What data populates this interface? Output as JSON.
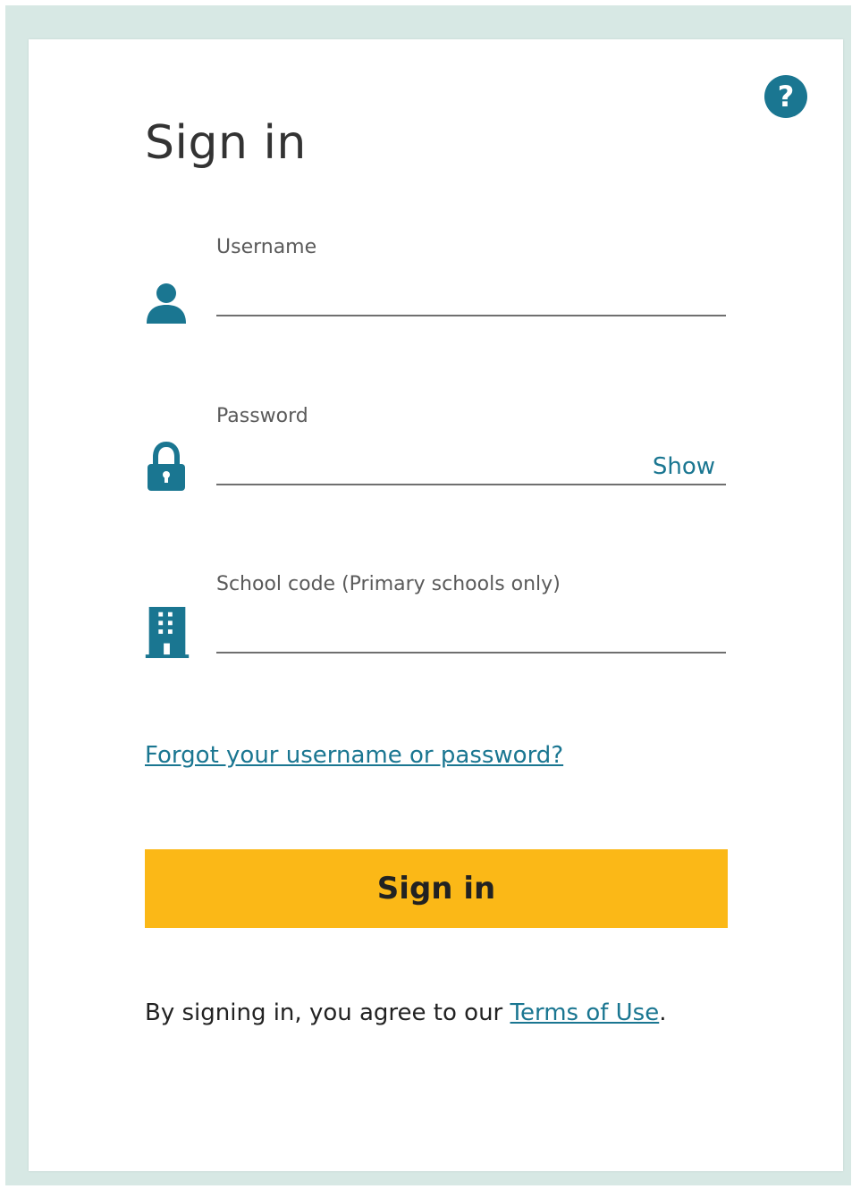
{
  "page": {
    "title": "Sign in",
    "help_label": "?"
  },
  "fields": {
    "username": {
      "label": "Username",
      "value": "",
      "icon": "user-icon"
    },
    "password": {
      "label": "Password",
      "value": "",
      "show_label": "Show",
      "icon": "lock-icon"
    },
    "school_code": {
      "label": "School code (Primary schools only)",
      "value": "",
      "icon": "building-icon"
    }
  },
  "links": {
    "forgot": "Forgot your username or password?"
  },
  "actions": {
    "sign_in_label": "Sign in"
  },
  "footer": {
    "terms_prefix": "By signing in, you agree to our ",
    "terms_link": "Terms of Use",
    "terms_suffix": "."
  },
  "colors": {
    "accent": "#1a7691",
    "button": "#fbb817",
    "background": "#d7e8e4"
  }
}
